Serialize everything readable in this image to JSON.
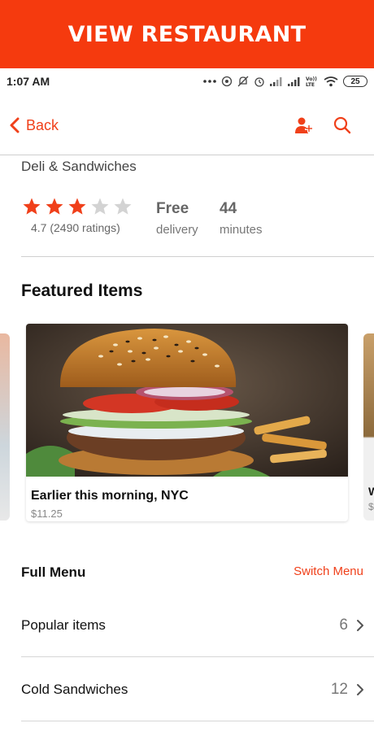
{
  "banner": {
    "title": "VIEW RESTAURANT"
  },
  "status_bar": {
    "time": "1:07 AM",
    "icons": [
      "more-dots-icon",
      "hotspot-icon",
      "mute-icon",
      "alarm-icon",
      "signal-icon",
      "signal-icon",
      "volte-icon",
      "wifi-icon",
      "battery-icon"
    ],
    "volte_label": "Vo)) LTE",
    "battery": "25"
  },
  "nav": {
    "back_label": "Back",
    "icons": [
      "chevron-left-icon",
      "user-add-icon",
      "search-icon"
    ]
  },
  "restaurant": {
    "category": "Deli & Sandwiches",
    "rating": {
      "stars_filled": 3,
      "stars_total": 5,
      "text": "4.7 (2490 ratings)"
    },
    "delivery": {
      "value": "Free",
      "label": "delivery"
    },
    "time": {
      "value": "44",
      "label": "minutes"
    }
  },
  "featured": {
    "title": "Featured Items",
    "items": [
      {
        "title": "Earlier this morning, NYC",
        "price": "$11.25"
      }
    ],
    "peek_right": {
      "title_start": "W",
      "price_start": "$"
    }
  },
  "menu": {
    "title": "Full Menu",
    "switch_label": "Switch Menu",
    "rows": [
      {
        "label": "Popular items",
        "count": "6"
      },
      {
        "label": "Cold Sandwiches",
        "count": "12"
      }
    ]
  },
  "colors": {
    "accent": "#f0401a",
    "banner": "#f53a0e",
    "star_filled": "#f0401a",
    "star_empty": "#d3d3d3"
  }
}
